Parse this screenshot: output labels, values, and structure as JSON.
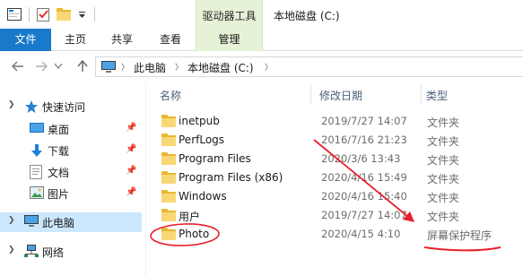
{
  "title_bar": {
    "context_tab_label": "驱动器工具",
    "window_title": "本地磁盘 (C:)"
  },
  "ribbon": {
    "tabs": [
      {
        "label": "文件"
      },
      {
        "label": "主页"
      },
      {
        "label": "共享"
      },
      {
        "label": "查看"
      },
      {
        "label": "管理"
      }
    ]
  },
  "address_bar": {
    "breadcrumbs": [
      {
        "label": "此电脑"
      },
      {
        "label": "本地磁盘 (C:)"
      }
    ]
  },
  "nav_pane": {
    "items": [
      {
        "label": "快速访问",
        "icon": "star-icon"
      },
      {
        "label": "桌面",
        "icon": "desktop-icon",
        "pinned": true
      },
      {
        "label": "下载",
        "icon": "download-icon",
        "pinned": true
      },
      {
        "label": "文档",
        "icon": "document-icon",
        "pinned": true
      },
      {
        "label": "图片",
        "icon": "picture-icon",
        "pinned": true
      },
      {
        "label": "此电脑",
        "icon": "computer-icon",
        "selected": true
      },
      {
        "label": "网络",
        "icon": "network-icon"
      }
    ]
  },
  "file_list": {
    "columns": {
      "name": "名称",
      "date": "修改日期",
      "type": "类型"
    },
    "rows": [
      {
        "name": "inetpub",
        "date": "2019/7/27 14:07",
        "type": "文件夹"
      },
      {
        "name": "PerfLogs",
        "date": "2016/7/16 21:23",
        "type": "文件夹"
      },
      {
        "name": "Program Files",
        "date": "2020/3/6 13:43",
        "type": "文件夹"
      },
      {
        "name": "Program Files (x86)",
        "date": "2020/4/16 15:49",
        "type": "文件夹"
      },
      {
        "name": "Windows",
        "date": "2020/4/16 15:40",
        "type": "文件夹"
      },
      {
        "name": "用户",
        "date": "2019/7/27 14:07",
        "type": "文件夹"
      },
      {
        "name": "Photo",
        "date": "2020/4/15 4:10",
        "type": "屏幕保护程序"
      }
    ]
  },
  "colors": {
    "accent": "#1979ca",
    "context_tab": "#e6f2d6",
    "selection": "#cce8ff",
    "annotation_red": "#e8202a",
    "folder_yellow": "#f8d775"
  }
}
